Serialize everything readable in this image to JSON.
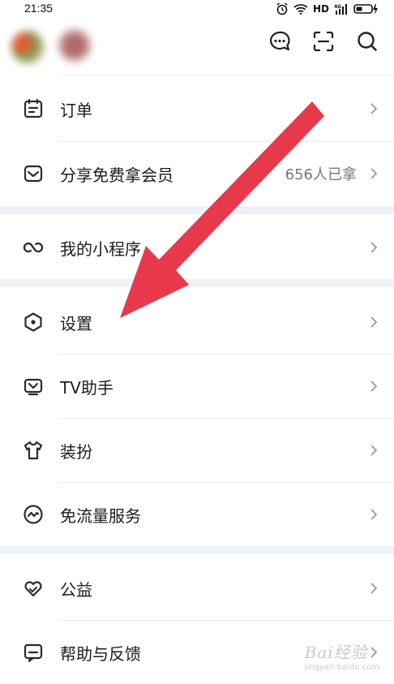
{
  "status_bar": {
    "time": "21:35",
    "network": "HD",
    "signal": "4G"
  },
  "menu": {
    "order": {
      "label": "订单"
    },
    "share": {
      "label": "分享免费拿会员",
      "extra": "656人已拿"
    },
    "mini_programs": {
      "label": "我的小程序"
    },
    "settings": {
      "label": "设置"
    },
    "tv_assistant": {
      "label": "TV助手"
    },
    "outfit": {
      "label": "装扮"
    },
    "free_data": {
      "label": "免流量服务"
    },
    "charity": {
      "label": "公益"
    },
    "help": {
      "label": "帮助与反馈"
    }
  },
  "watermark": {
    "brand": "Bai经验",
    "url": "jingyan.baidu.com"
  },
  "colors": {
    "arrow": "#e8394c",
    "section_gap": "#eef2f7",
    "icon": "#2b2b2b"
  }
}
